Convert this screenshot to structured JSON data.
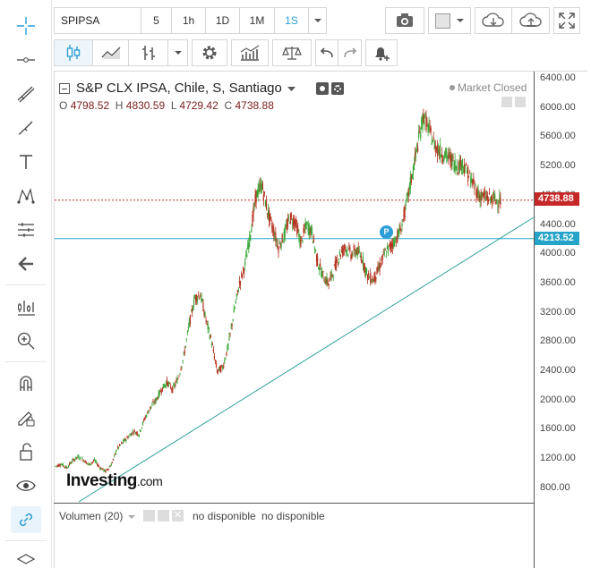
{
  "toolbar": {
    "symbol": "SPIPSA",
    "intervals": [
      "5",
      "1h",
      "1D",
      "1M",
      "1S"
    ],
    "active_interval": "1S",
    "icons": [
      "dropdown-icon",
      "camera-icon",
      "color-square-icon",
      "cloud-download-icon",
      "cloud-upload-icon",
      "fullscreen-icon"
    ]
  },
  "second_toolbar": {
    "icons": [
      "candles-icon",
      "area-icon",
      "bars-icon",
      "chevron-down-icon",
      "gear-icon",
      "indicators-icon",
      "scale-icon",
      "undo-icon",
      "redo-icon",
      "alert-bell-icon"
    ]
  },
  "left_tools": [
    "crosshair-icon",
    "horizontal-line-icon",
    "trend-lines-icon",
    "brush-icon",
    "text-icon",
    "pattern-icon",
    "measure-icon",
    "back-arrow-icon",
    "layout-icon",
    "zoom-icon",
    "magnet-icon",
    "lock-pencil-icon",
    "unlock-icon",
    "eye-icon",
    "link-icon",
    "layers-icon"
  ],
  "legend": {
    "title": "S&P CLX IPSA, Chile, S, Santiago",
    "open_label": "O",
    "open": "4798.52",
    "high_label": "H",
    "high": "4830.59",
    "low_label": "L",
    "low": "4729.42",
    "close_label": "C",
    "close": "4738.88",
    "market_status": "Market Closed"
  },
  "price_axis": {
    "ticks": [
      "6400.00",
      "6000.00",
      "5600.00",
      "5200.00",
      "4800.00",
      "4400.00",
      "4000.00",
      "3600.00",
      "3200.00",
      "2800.00",
      "2400.00",
      "2000.00",
      "1600.00",
      "1200.00",
      "800.00"
    ],
    "last_price": "4738.88",
    "line_price": "4213.52",
    "last_color": "#c62828",
    "line_color": "#26a3c8"
  },
  "volume": {
    "label": "Volumen (20)",
    "value1": "no disponible",
    "value2": "no disponible"
  },
  "logo": {
    "brand": "Investing",
    "suffix": ".com"
  },
  "marker": {
    "label": "P"
  },
  "chart_data": {
    "type": "line",
    "title": "S&P CLX IPSA, Chile, S, Santiago",
    "ylim": [
      600,
      6500
    ],
    "x": [
      0,
      10,
      20,
      30,
      40,
      50,
      60,
      70,
      80,
      90,
      100,
      110,
      120,
      130,
      140,
      150,
      160,
      170,
      180,
      190,
      200,
      210,
      220,
      230,
      240,
      250,
      260,
      270,
      280,
      290,
      300,
      310,
      320,
      330,
      340,
      350,
      360,
      370,
      380,
      390,
      400,
      410,
      420,
      430,
      440,
      450,
      460,
      470,
      480,
      490,
      500,
      510,
      520,
      530,
      540,
      550,
      560,
      570,
      580,
      590,
      600,
      610,
      620,
      630,
      640,
      650,
      660,
      670,
      680,
      690,
      700,
      710,
      720,
      730,
      740,
      750,
      760,
      770,
      780,
      790,
      800
    ],
    "values": [
      1100,
      1130,
      1080,
      1170,
      1230,
      1190,
      1120,
      1180,
      1080,
      1030,
      1120,
      1330,
      1420,
      1500,
      1580,
      1540,
      1750,
      1900,
      2000,
      2150,
      2250,
      2150,
      2300,
      2600,
      3050,
      3400,
      3450,
      3100,
      2800,
      2400,
      2450,
      2750,
      3200,
      3600,
      3850,
      4300,
      4800,
      4950,
      4600,
      4350,
      4100,
      4250,
      4500,
      4450,
      4150,
      4400,
      4300,
      3900,
      3700,
      3600,
      3800,
      4000,
      4100,
      4000,
      4050,
      3950,
      3700,
      3650,
      3800,
      4000,
      4100,
      4200,
      4350,
      4700,
      5100,
      5500,
      5900,
      5700,
      5500,
      5400,
      5350,
      5300,
      5200,
      5250,
      5100,
      4950,
      4800,
      4780,
      4760,
      4740,
      4738.88
    ],
    "levels": [
      {
        "name": "",
        "value": 4738.88
      },
      {
        "name": "",
        "value": 4213.52
      }
    ]
  }
}
